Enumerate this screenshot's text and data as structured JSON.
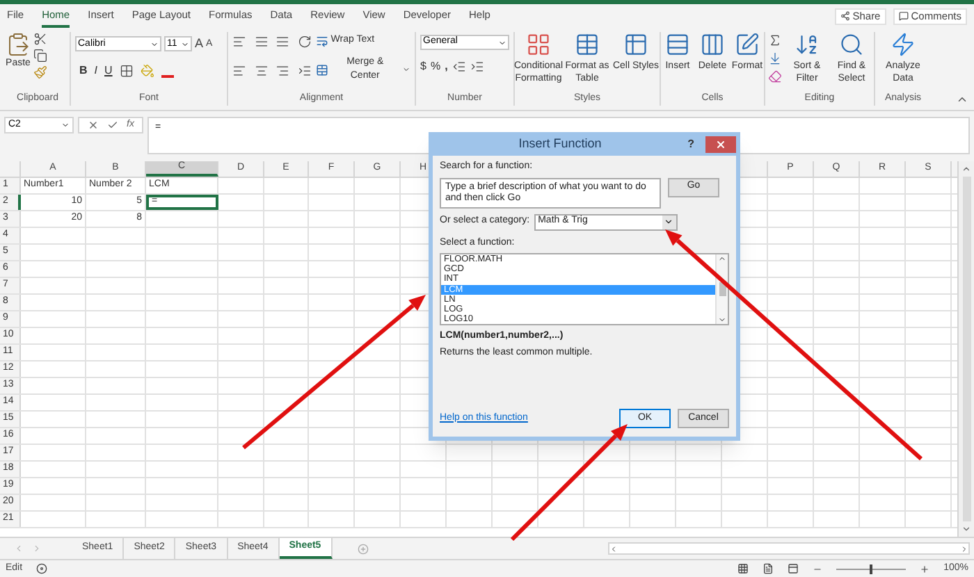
{
  "title_bar": {
    "share": "Share",
    "comments": "Comments"
  },
  "menu_tabs": [
    {
      "label": "File",
      "selected": false
    },
    {
      "label": "Home",
      "selected": true
    },
    {
      "label": "Insert",
      "selected": false
    },
    {
      "label": "Page Layout",
      "selected": false
    },
    {
      "label": "Formulas",
      "selected": false
    },
    {
      "label": "Data",
      "selected": false
    },
    {
      "label": "Review",
      "selected": false
    },
    {
      "label": "View",
      "selected": false
    },
    {
      "label": "Developer",
      "selected": false
    },
    {
      "label": "Help",
      "selected": false
    }
  ],
  "ribbon": {
    "clipboard": {
      "paste": "Paste",
      "group": "Clipboard"
    },
    "font": {
      "name": "Calibri",
      "size": "11",
      "grow": "A",
      "shrink": "A",
      "bold": "B",
      "italic": "I",
      "underline": "U",
      "group": "Font"
    },
    "alignment": {
      "wrap": "Wrap Text",
      "merge": "Merge & Center",
      "group": "Alignment"
    },
    "number": {
      "format": "General",
      "currency": "$",
      "percent": "%",
      "comma": ",",
      "group": "Number"
    },
    "styles": {
      "buttons": [
        "Conditional Formatting",
        "Format as Table",
        "Cell Styles"
      ],
      "group": "Styles"
    },
    "cells": {
      "buttons": [
        "Insert",
        "Delete",
        "Format"
      ],
      "group": "Cells"
    },
    "editing": {
      "buttons": [
        "Sort & Filter",
        "Find & Select"
      ],
      "group": "Editing"
    },
    "analysis": {
      "buttons": [
        "Analyze Data"
      ],
      "group": "Analysis"
    }
  },
  "formula_bar": {
    "name_box": "C2",
    "function_symbol": "fx",
    "formula": "="
  },
  "sheet": {
    "columns_left": [
      "A",
      "B",
      "C",
      "D",
      "E",
      "F",
      "G",
      "H"
    ],
    "columns_right": [
      "P",
      "Q",
      "R",
      "S"
    ],
    "rows": [
      {
        "header": "1",
        "cells": [
          {
            "value": "Number1",
            "kind": "text",
            "selected": false
          },
          {
            "value": "Number 2",
            "kind": "text",
            "selected": false
          },
          {
            "value": "LCM",
            "kind": "text",
            "selected": false
          }
        ]
      },
      {
        "header": "2",
        "cells": [
          {
            "value": "10",
            "kind": "number",
            "selected": false
          },
          {
            "value": "5",
            "kind": "number",
            "selected": false
          },
          {
            "value": "=",
            "kind": "text",
            "selected": true
          }
        ]
      },
      {
        "header": "3",
        "cells": [
          {
            "value": "20",
            "kind": "number",
            "selected": false
          },
          {
            "value": "8",
            "kind": "number",
            "selected": false
          }
        ]
      },
      {
        "header": "4"
      },
      {
        "header": "5"
      },
      {
        "header": "6"
      },
      {
        "header": "7"
      },
      {
        "header": "8"
      },
      {
        "header": "9"
      },
      {
        "header": "10"
      },
      {
        "header": "11"
      },
      {
        "header": "12"
      },
      {
        "header": "13"
      },
      {
        "header": "14"
      },
      {
        "header": "15"
      },
      {
        "header": "16"
      },
      {
        "header": "17"
      },
      {
        "header": "18"
      },
      {
        "header": "19"
      },
      {
        "header": "20"
      },
      {
        "header": "21"
      }
    ]
  },
  "sheet_tabs": [
    {
      "label": "Sheet1",
      "selected": false
    },
    {
      "label": "Sheet2",
      "selected": false
    },
    {
      "label": "Sheet3",
      "selected": false
    },
    {
      "label": "Sheet4",
      "selected": false
    },
    {
      "label": "Sheet5",
      "selected": true
    }
  ],
  "status_bar": {
    "mode": "Edit",
    "level": 0.5,
    "zoom": "100%"
  },
  "dialog": {
    "title": "Insert Function",
    "help": "?",
    "search_label": "Search for a function:",
    "search_text": "Type a brief description of what you want to do and then click Go",
    "go": "Go",
    "category_label": "Or select a category:",
    "category": "Math & Trig",
    "list_label": "Select a function:",
    "functions": [
      {
        "name": "FLOOR.MATH",
        "selected": false
      },
      {
        "name": "GCD",
        "selected": false
      },
      {
        "name": "INT",
        "selected": false
      },
      {
        "name": "LCM",
        "selected": true
      },
      {
        "name": "LN",
        "selected": false
      },
      {
        "name": "LOG",
        "selected": false
      },
      {
        "name": "LOG10",
        "selected": false
      }
    ],
    "signature": "LCM(number1,number2,...)",
    "description": "Returns the least common multiple.",
    "help_link": "Help on this function",
    "ok": "OK",
    "cancel": "Cancel"
  }
}
